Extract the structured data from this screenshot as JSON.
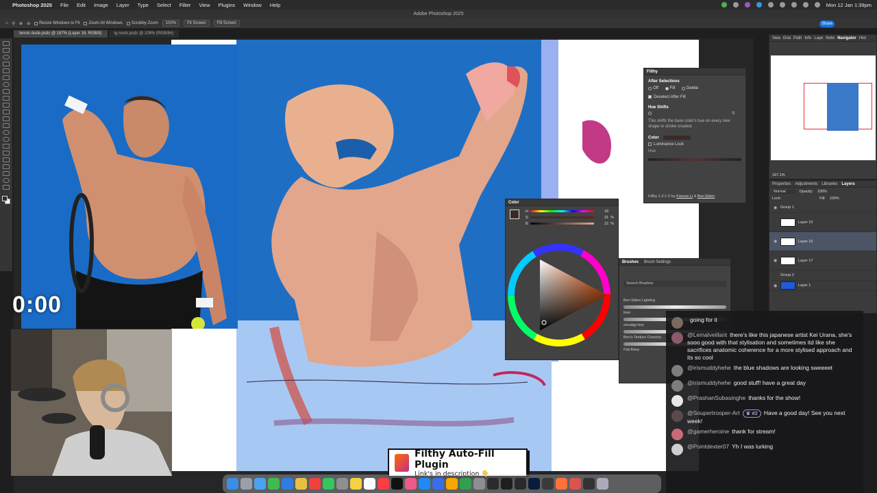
{
  "menubar": {
    "app": "Photoshop 2025",
    "items": [
      "File",
      "Edit",
      "Image",
      "Layer",
      "Type",
      "Select",
      "Filter",
      "View",
      "Plugins",
      "Window",
      "Help"
    ],
    "clock": "Mon 12 Jan 1:39pm"
  },
  "window_title": "Adobe Photoshop 2025",
  "options": {
    "resize_windows": "Resize Windows to Fit",
    "zoom_all": "Zoom All Windows",
    "scrubby": "Scrubby Zoom",
    "zoom_value": "100%",
    "fit_screen": "Fit Screen",
    "fill_screen": "Fill Screen",
    "share": "Share"
  },
  "doc_tabs": [
    "tennis dude.psdc @ 187% (Layer 16, RGB/8)",
    "ig mock.psdc @ 108% (RGB/8#)"
  ],
  "timer": "0:00",
  "filthy": {
    "title": "Filthy",
    "after_selections": "After Selections",
    "opt_off": "Off",
    "opt_fill": "Fill",
    "opt_delete": "Delete",
    "deselect_after_fill": "Deselect After Fill",
    "hue_shifts": "Hue Shifts",
    "hue_value": "0",
    "hue_desc": "This shifts the base color's hue on every new shape or stroke created.",
    "color_label": "Color",
    "luminance_lock": "Luminance Lock",
    "hue_label": "Hue",
    "credit_prefix": "Filthy 1.3.1 © by",
    "credit_a": "Francis Li",
    "credit_and": "&",
    "credit_b": "Ben Eblen"
  },
  "color_panel": {
    "title": "Color",
    "h_label": "H",
    "h_value": "18",
    "s_label": "S",
    "s_value": "31",
    "b_label": "B",
    "b_value": "22",
    "pct": "%"
  },
  "brushes_panel": {
    "tab1": "Brushes",
    "tab2": "Brush Settings",
    "search": "Search Brushes",
    "group": "Ben Eblen Lighting",
    "b1": "liner",
    "b2": "smudgy-boy",
    "b3": "Ben's Texture Crunchy",
    "b4": "Flat flowy"
  },
  "navigator": {
    "tabs": [
      "Swa",
      "Grai",
      "Path",
      "Info",
      "Laye",
      "Note",
      "Navigator",
      "Hist"
    ],
    "zoom": "187.1%"
  },
  "layers_panel": {
    "tabs": [
      "Properties",
      "Adjustments",
      "Libraries",
      "Layers"
    ],
    "blend": "Normal",
    "opacity_label": "Opacity:",
    "opacity": "100%",
    "lock_label": "Lock:",
    "fill_label": "Fill:",
    "fill": "100%",
    "rows": [
      "Group 1",
      "Layer 15",
      "Layer 16",
      "Layer 17",
      "Group 2",
      "Layer 1"
    ]
  },
  "chat": [
    {
      "user": "",
      "text": "going for it",
      "avatar": "#7a6a60"
    },
    {
      "user": "@Lemalveillant",
      "text": "there's like this japanese artist Kei Urana, she's sooo good with that stylisation and sometimes itd like she sacrifices anatomic coherence for a more stylised approach and its so cool",
      "avatar": "#8c5a6a"
    },
    {
      "user": "@irismuddyhehe",
      "text": "the blue shadows are looking sweeeet",
      "avatar": "#7d7d7d"
    },
    {
      "user": "@irismuddyhehe",
      "text": "good stuff! have a great day",
      "avatar": "#7d7d7d"
    },
    {
      "user": "@PrashanSubasinghe",
      "text": "thanks for the show!",
      "avatar": "#e8e8e8"
    },
    {
      "user": "@Soupertrooper-Art",
      "badge": "#2",
      "text": "Have a good day! See you next week!",
      "avatar": "#5a4a4a"
    },
    {
      "user": "@gamerheroine",
      "text": "thank for stream!",
      "avatar": "#c86a7a"
    },
    {
      "user": "@Pointdexter07",
      "text": "Yh I was lurking",
      "avatar": "#cfcfcf"
    }
  ],
  "banner": {
    "title": "Filthy Auto-Fill Plugin",
    "subtitle": "Link's in description 👇"
  },
  "colors": {
    "accent": "#1473e6",
    "canvas_blue": "#1a6bc6",
    "skin": "#e8a48a"
  }
}
